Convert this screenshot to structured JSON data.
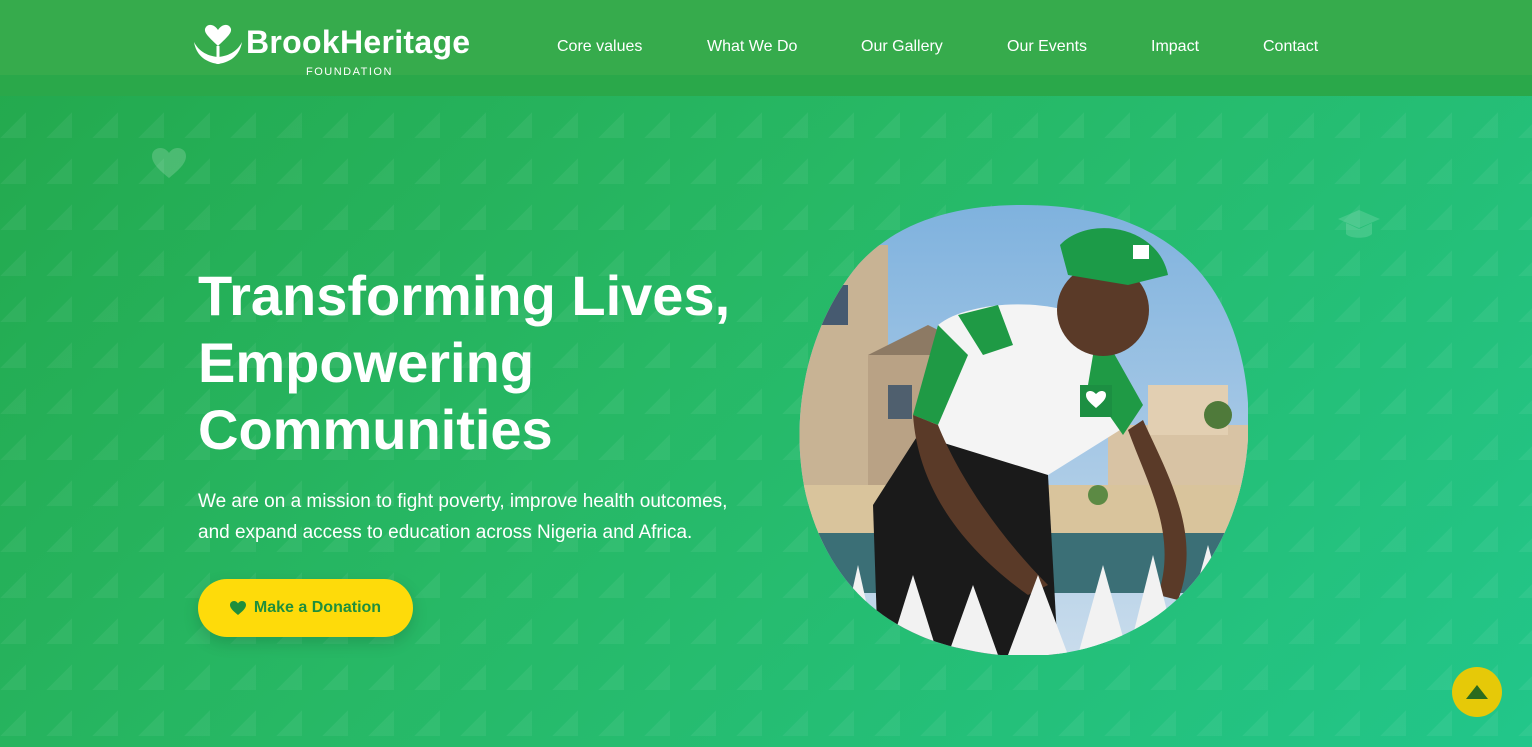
{
  "header": {
    "logo_name": "BrookHeritage",
    "logo_sub": "FOUNDATION",
    "nav": [
      {
        "label": "Core values"
      },
      {
        "label": "What We Do"
      },
      {
        "label": "Our Gallery"
      },
      {
        "label": "Our Events"
      },
      {
        "label": "Impact"
      },
      {
        "label": "Contact"
      }
    ]
  },
  "hero": {
    "title_lines": [
      "Transforming Lives,",
      "Empowering",
      "Communities"
    ],
    "description": "We are on a mission to fight poverty, improve health outcomes, and expand access to education across Nigeria and Africa.",
    "cta_label": "Make a Donation",
    "cta_icon": "heart-icon",
    "image_icon": "volunteer-photo"
  },
  "colors": {
    "brand_green": "#2aa84a",
    "cta_yellow": "#fedb0a",
    "cta_text": "#1f8f3c",
    "scroll_button": "#e6c908"
  },
  "icons": {
    "decorative_heart": "heart-icon",
    "decorative_cap": "graduation-cap-icon",
    "scroll_top": "arrow-up-icon"
  }
}
